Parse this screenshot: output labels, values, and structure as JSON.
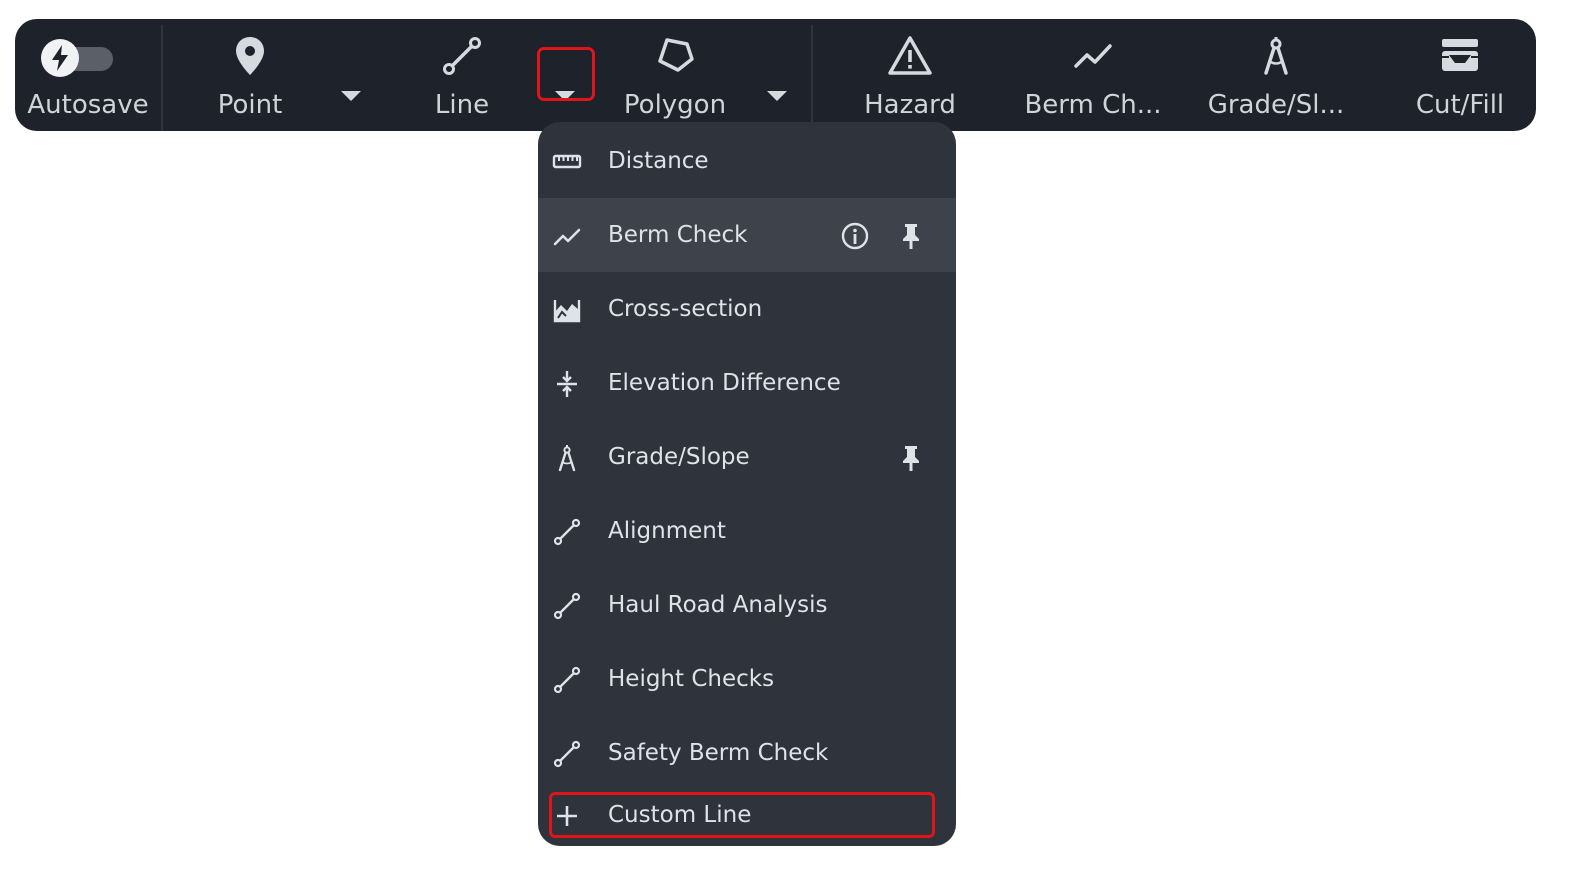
{
  "toolbar": {
    "autosave": {
      "label": "Autosave",
      "enabled": false
    },
    "tools": [
      {
        "label": "Point",
        "icon": "map-pin-icon"
      },
      {
        "label": "Line",
        "icon": "line-segment-icon"
      },
      {
        "label": "Polygon",
        "icon": "polygon-icon"
      },
      {
        "label": "Hazard",
        "icon": "warning-triangle-icon"
      },
      {
        "label": "Berm Ch...",
        "icon": "trend-line-icon"
      },
      {
        "label": "Grade/Sl...",
        "icon": "compass-icon"
      },
      {
        "label": "Cut/Fill",
        "icon": "cut-fill-icon"
      }
    ]
  },
  "line_menu": {
    "items": [
      {
        "label": "Distance",
        "icon": "ruler-icon"
      },
      {
        "label": "Berm Check",
        "icon": "trend-line-icon",
        "info": true,
        "pinned": true,
        "highlighted": true
      },
      {
        "label": "Cross-section",
        "icon": "cross-section-icon"
      },
      {
        "label": "Elevation Difference",
        "icon": "elevation-difference-icon"
      },
      {
        "label": "Grade/Slope",
        "icon": "compass-icon",
        "pinned": true
      },
      {
        "label": "Alignment",
        "icon": "line-segment-icon"
      },
      {
        "label": "Haul Road Analysis",
        "icon": "line-segment-icon"
      },
      {
        "label": "Height Checks",
        "icon": "line-segment-icon"
      },
      {
        "label": "Safety Berm Check",
        "icon": "line-segment-icon"
      },
      {
        "label": "Custom Line",
        "icon": "plus-icon"
      }
    ]
  },
  "colors": {
    "toolbar_bg": "#1d222b",
    "menu_bg": "#2e333c",
    "menu_highlight": "#3d424b",
    "callout_red": "#e0141b",
    "text": "#d0d3d8"
  }
}
